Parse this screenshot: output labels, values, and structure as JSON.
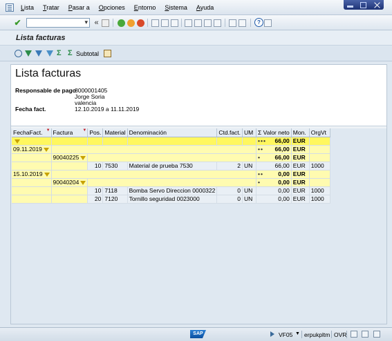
{
  "menu": {
    "items": [
      "Lista",
      "Tratar",
      "Pasar a",
      "Opciones",
      "Entorno",
      "Sistema",
      "Ayuda"
    ]
  },
  "title": "Lista facturas",
  "app_toolbar": {
    "subtotal_label": "Subtotal"
  },
  "header": {
    "title": "Lista facturas",
    "payer_label": "Responsable de pago",
    "payer_number": "8000001405",
    "payer_name": "Jorge Soria",
    "payer_city": "valencia",
    "date_label": "Fecha fact.",
    "date_range": "12.10.2019 a 11.11.2019"
  },
  "table": {
    "columns": [
      "FechaFact.",
      "Factura",
      "Pos.",
      "Material",
      "Denominación",
      "Ctd.fact.",
      "UM",
      "Σ",
      "Valor neto",
      "Mon.",
      "OrgVt"
    ],
    "rows": [
      {
        "fecha": "",
        "factura": "",
        "pos": "",
        "material": "",
        "denom": "",
        "ctd": "",
        "um": "",
        "stars": "•••",
        "valor": "66,00",
        "mon": "EUR",
        "orgvt": ""
      },
      {
        "fecha": "09.11.2019",
        "factura": "",
        "pos": "",
        "material": "",
        "denom": "",
        "ctd": "",
        "um": "",
        "stars": "••",
        "valor": "66,00",
        "mon": "EUR",
        "orgvt": ""
      },
      {
        "fecha": "",
        "factura": "90040225",
        "pos": "",
        "material": "",
        "denom": "",
        "ctd": "",
        "um": "",
        "stars": "•",
        "valor": "66,00",
        "mon": "EUR",
        "orgvt": ""
      },
      {
        "fecha": "",
        "factura": "",
        "pos": "10",
        "material": "7530",
        "denom": "Material de prueba 7530",
        "ctd": "2",
        "um": "UN",
        "stars": "",
        "valor": "66,00",
        "mon": "EUR",
        "orgvt": "1000"
      },
      {
        "fecha": "15.10.2019",
        "factura": "",
        "pos": "",
        "material": "",
        "denom": "",
        "ctd": "",
        "um": "",
        "stars": "••",
        "valor": "0,00",
        "mon": "EUR",
        "orgvt": ""
      },
      {
        "fecha": "",
        "factura": "90040204",
        "pos": "",
        "material": "",
        "denom": "",
        "ctd": "",
        "um": "",
        "stars": "•",
        "valor": "0,00",
        "mon": "EUR",
        "orgvt": ""
      },
      {
        "fecha": "",
        "factura": "",
        "pos": "10",
        "material": "7118",
        "denom": "Bomba Servo Direccion 0000322",
        "ctd": "0",
        "um": "UN",
        "stars": "",
        "valor": "0,00",
        "mon": "EUR",
        "orgvt": "1000"
      },
      {
        "fecha": "",
        "factura": "",
        "pos": "20",
        "material": "7120",
        "denom": "Tornillo seguridad 0023000",
        "ctd": "0",
        "um": "UN",
        "stars": "",
        "valor": "0,00",
        "mon": "EUR",
        "orgvt": "1000"
      }
    ]
  },
  "status": {
    "sap_logo": "SAP",
    "transaction": "VF05",
    "server": "erpukpltm",
    "mode": "OVR"
  },
  "colors": {
    "yellow_total": "#fff75e",
    "yellow_sub": "#fffbb0",
    "accent": "#1d3275"
  }
}
